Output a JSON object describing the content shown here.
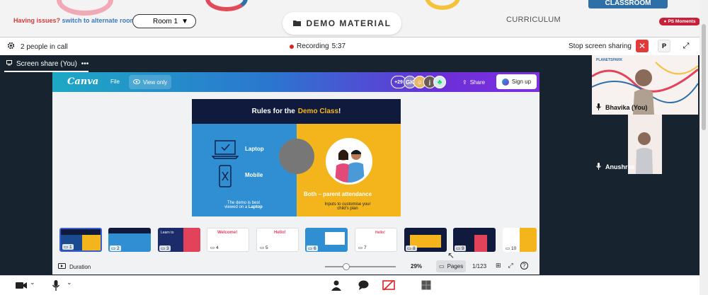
{
  "header": {
    "issues_warning": "Having issues?",
    "issues_link": "switch to alternate room",
    "room_select": "Room 1",
    "demo_button": "DEMO MATERIAL",
    "curriculum_tab": "CURRICULUM",
    "classroom_tab": "CLASSROOM",
    "ps_moments": "PS Moments"
  },
  "call": {
    "people_count": "2 people in call",
    "recording_label": "Recording",
    "recording_time": "5:37",
    "stop_sharing": "Stop screen sharing",
    "pin_label": "P",
    "screen_share_tab": "Screen share (You)"
  },
  "canva": {
    "logo": "Canva",
    "file_menu": "File",
    "view_only": "View only",
    "collaborator_count": "+29",
    "avatar_initials": [
      "GK",
      "j"
    ],
    "share_button": "Share",
    "signup_button": "Sign up",
    "duration_label": "Duration",
    "zoom_percent": "29%",
    "zoom_level": 0.3,
    "pages_button": "Pages",
    "page_counter": "1/123"
  },
  "slide": {
    "title_prefix": "Rules for the",
    "title_highlight": "Demo Class",
    "title_suffix": "!",
    "laptop_label": "Laptop",
    "mobile_label": "Mobile",
    "demo_best_line1": "The demo is best",
    "demo_best_line2_prefix": "viewed on a",
    "demo_best_line2_bold": "Laptop",
    "parent_attendance": "Both – parent attendance",
    "customise_line1": "Inputs to customise your",
    "customise_line2": "child's plan"
  },
  "thumbnails": [
    {
      "num": "1",
      "title": ""
    },
    {
      "num": "2",
      "title": ""
    },
    {
      "num": "3",
      "title": "Learn to"
    },
    {
      "num": "4",
      "title": "Welcome!"
    },
    {
      "num": "5",
      "title": "Hello!"
    },
    {
      "num": "6",
      "title": ""
    },
    {
      "num": "7",
      "title": "Hello!"
    },
    {
      "num": "8",
      "title": ""
    },
    {
      "num": "9",
      "title": ""
    },
    {
      "num": "10",
      "title": ""
    }
  ],
  "participants": [
    {
      "name": "Bhavika (You)",
      "logo_text": "PLANETSPARK"
    },
    {
      "name": "Anushree"
    }
  ],
  "colors": {
    "recording_dot": "#dd2222",
    "stop_button": "#e03a3a",
    "slide_header": "#101a3d",
    "slide_blue": "#2f8fd2",
    "slide_yellow": "#f3b51b",
    "highlight": "#f5b81c"
  },
  "icons": {
    "settings": "gear-icon",
    "more": "more-icon",
    "camera": "camera-icon",
    "mic": "mic-icon",
    "people": "people-icon",
    "chat": "chat-icon",
    "screen_share_off": "screen-share-off-icon",
    "whiteboard": "whiteboard-icon"
  }
}
